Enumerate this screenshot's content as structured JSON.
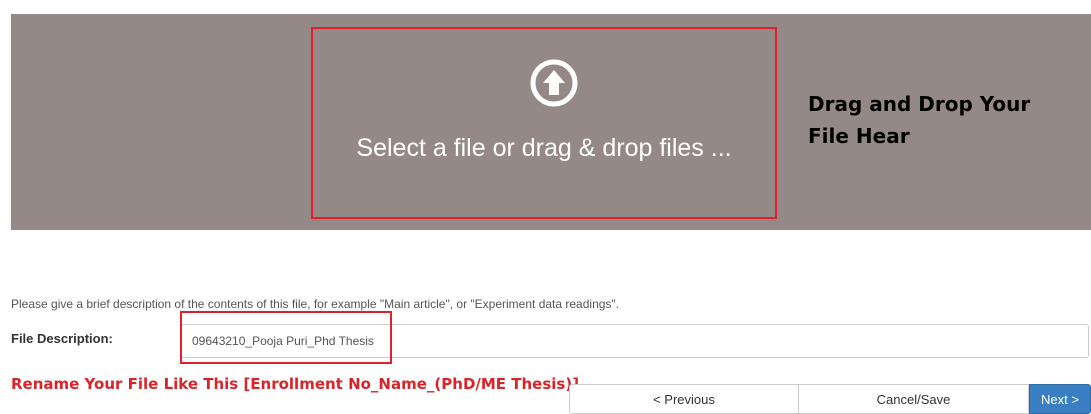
{
  "dropzone": {
    "icon": "upload-arrow-icon",
    "text": "Select a file or drag & drop files ...",
    "background_color": "#948987",
    "highlight_color": "#e0202a"
  },
  "annotation": {
    "hint": "Drag and Drop Your File Hear",
    "rename_note": "Rename Your File Like This [Enrollment No_Name_(PhD/ME Thesis)]"
  },
  "form": {
    "description_help": "Please give a brief description of the contents of this file, for example \"Main article\", or \"Experiment data readings\".",
    "file_description_label": "File Description:",
    "file_description_value": "09643210_Pooja Puri_Phd Thesis"
  },
  "buttons": {
    "previous": "< Previous",
    "cancel_save": "Cancel/Save",
    "next": "Next >",
    "primary_color": "#3a7fc4"
  }
}
